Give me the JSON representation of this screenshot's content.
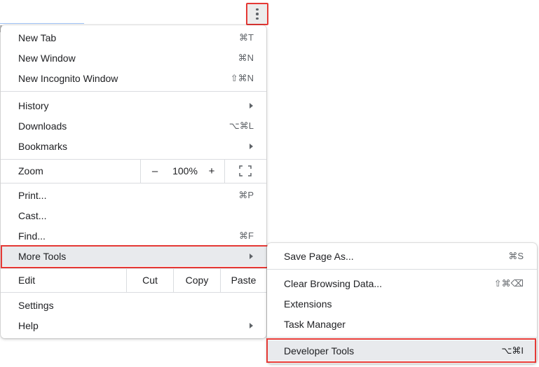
{
  "toolbar": {
    "menu_icon": "kebab-icon"
  },
  "menu": {
    "items": [
      {
        "label": "New Tab",
        "shortcut": "⌘T"
      },
      {
        "label": "New Window",
        "shortcut": "⌘N"
      },
      {
        "label": "New Incognito Window",
        "shortcut": "⇧⌘N"
      },
      {
        "label": "History",
        "submenu": true
      },
      {
        "label": "Downloads",
        "shortcut": "⌥⌘L"
      },
      {
        "label": "Bookmarks",
        "submenu": true
      },
      {
        "label": "Print...",
        "shortcut": "⌘P"
      },
      {
        "label": "Cast..."
      },
      {
        "label": "Find...",
        "shortcut": "⌘F"
      },
      {
        "label": "More Tools",
        "submenu": true
      },
      {
        "label": "Settings"
      },
      {
        "label": "Help",
        "submenu": true
      }
    ],
    "zoom": {
      "label": "Zoom",
      "minus": "–",
      "value": "100%",
      "plus": "+",
      "fullscreen_icon": "fullscreen-icon"
    },
    "edit": {
      "label": "Edit",
      "cut": "Cut",
      "copy": "Copy",
      "paste": "Paste"
    }
  },
  "submenu": {
    "items": [
      {
        "label": "Save Page As...",
        "shortcut": "⌘S"
      },
      {
        "label": "Clear Browsing Data...",
        "shortcut": "⇧⌘⌫"
      },
      {
        "label": "Extensions"
      },
      {
        "label": "Task Manager"
      },
      {
        "label": "Developer Tools",
        "shortcut": "⌥⌘I"
      }
    ]
  },
  "colors": {
    "highlight_outline": "#e53935",
    "hover_bg": "#e8eaed"
  }
}
